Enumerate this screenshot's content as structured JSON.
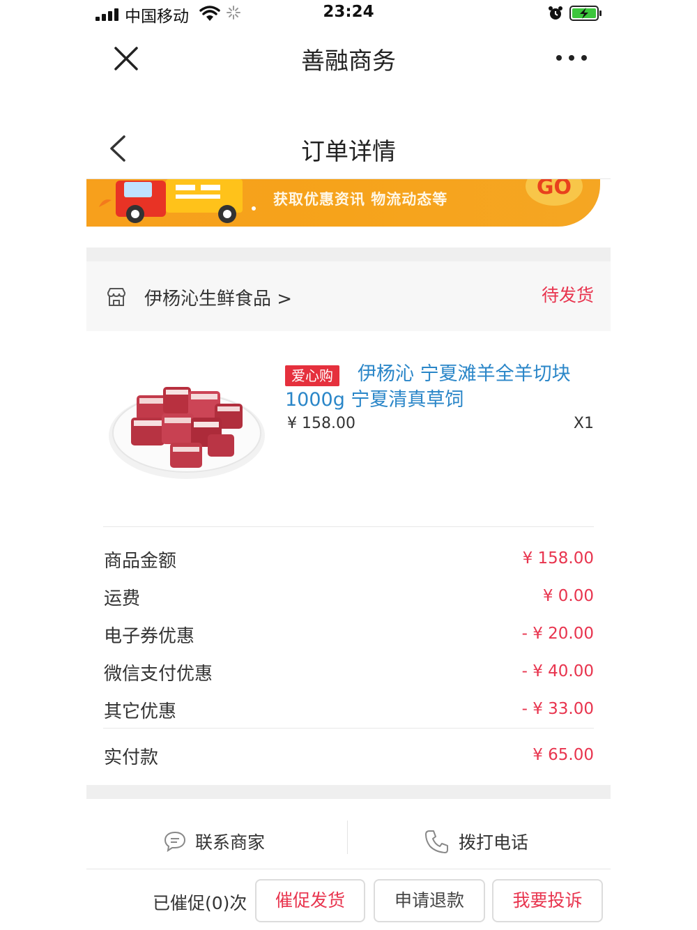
{
  "status_bar": {
    "carrier": "中国移动",
    "time": "23:24"
  },
  "nav": {
    "app_title": "善融商务",
    "page_title": "订单详情"
  },
  "banner": {
    "text": "获取优惠资讯 物流动态等",
    "go_label": "GO"
  },
  "store": {
    "name": "伊杨沁生鲜食品 >",
    "status": "待发货"
  },
  "product": {
    "tag": "爱心购",
    "title": "伊杨沁 宁夏滩羊全羊切块 1000g 宁夏清真草饲",
    "price": "¥ 158.00",
    "quantity": "X1"
  },
  "summary": [
    {
      "label": "商品金额",
      "value": "¥ 158.00"
    },
    {
      "label": "运费",
      "value": "¥ 0.00"
    },
    {
      "label": "电子券优惠",
      "value": "- ¥ 20.00"
    },
    {
      "label": "微信支付优惠",
      "value": "- ¥ 40.00"
    },
    {
      "label": "其它优惠",
      "value": "- ¥ 33.00"
    }
  ],
  "total": {
    "label": "实付款",
    "value": "¥ 65.00"
  },
  "contact": {
    "merchant_label": "联系商家",
    "call_label": "拨打电话"
  },
  "actions": {
    "urge_count": "已催促(0)次",
    "urge_label": "催促发货",
    "refund_label": "申请退款",
    "complain_label": "我要投诉"
  },
  "colors": {
    "accent_red": "#e8344e",
    "link_blue": "#2a86c8",
    "banner_orange": "#f7a01c",
    "tag_red": "#e5303d"
  }
}
